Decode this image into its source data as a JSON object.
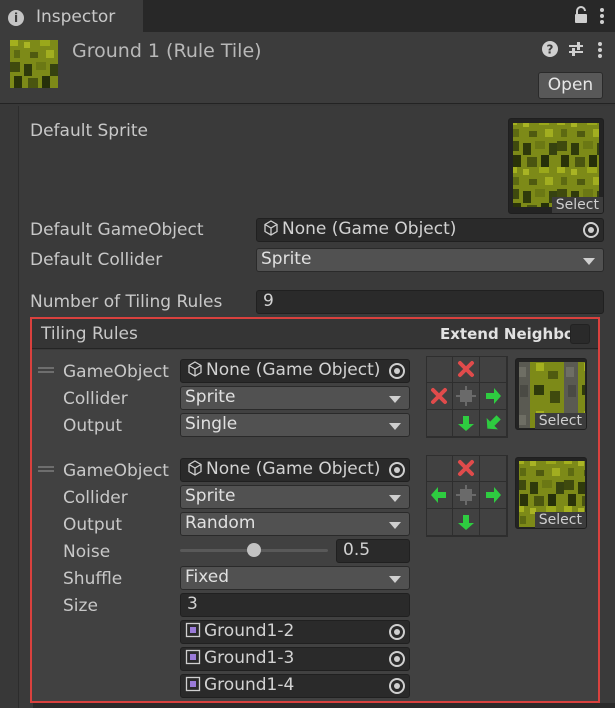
{
  "tab": {
    "label": "Inspector",
    "icon": "info-icon"
  },
  "header": {
    "title": "Ground 1 (Rule Tile)",
    "open_label": "Open",
    "icons": [
      "help-icon",
      "preset-icon",
      "more-icon"
    ]
  },
  "fields": {
    "default_sprite_label": "Default Sprite",
    "select_label": "Select",
    "default_gameobject_label": "Default GameObject",
    "default_gameobject_value": "None (Game Object)",
    "default_collider_label": "Default Collider",
    "default_collider_value": "Sprite",
    "num_rules_label": "Number of Tiling Rules",
    "num_rules_value": "9"
  },
  "tiling_rules": {
    "title": "Tiling Rules",
    "extend_neighbor_label": "Extend Neighbor",
    "extend_neighbor_checked": false,
    "rules": [
      {
        "gameobject_label": "GameObject",
        "gameobject_value": "None (Game Object)",
        "collider_label": "Collider",
        "collider_value": "Sprite",
        "output_label": "Output",
        "output_value": "Single",
        "select_label": "Select"
      },
      {
        "gameobject_label": "GameObject",
        "gameobject_value": "None (Game Object)",
        "collider_label": "Collider",
        "collider_value": "Sprite",
        "output_label": "Output",
        "output_value": "Random",
        "noise_label": "Noise",
        "noise_value": "0.5",
        "shuffle_label": "Shuffle",
        "shuffle_value": "Fixed",
        "size_label": "Size",
        "size_value": "3",
        "sprites": [
          "Ground1-2",
          "Ground1-3",
          "Ground1-4"
        ],
        "select_label": "Select"
      }
    ]
  },
  "colors": {
    "accent_red": "#d9413e",
    "neighbor_green": "#2ecc40",
    "neighbor_red": "#e04b4b"
  }
}
